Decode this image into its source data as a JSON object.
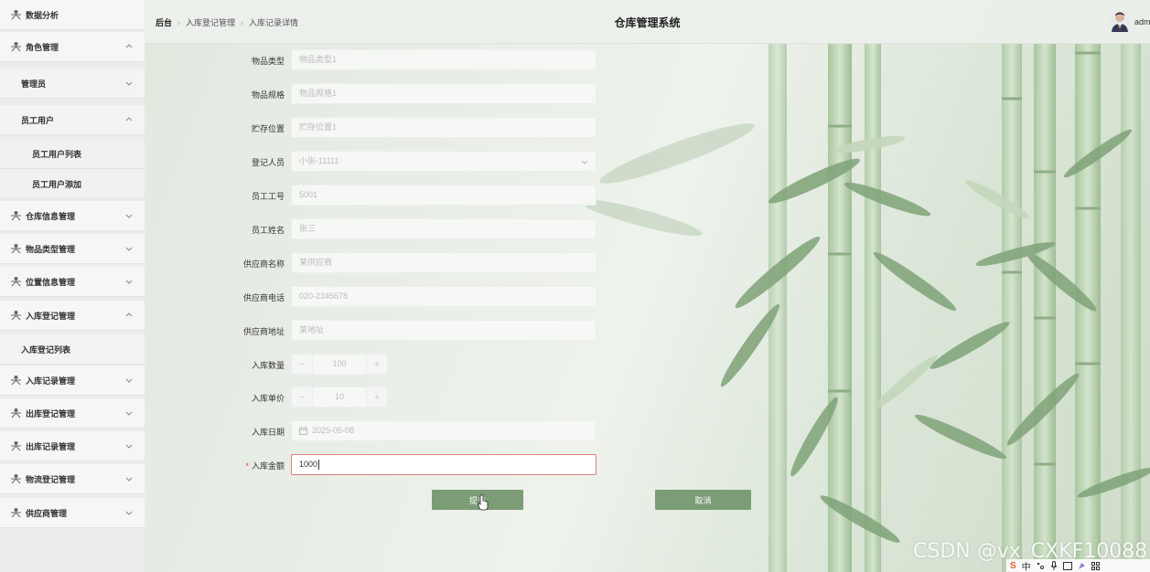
{
  "sidebar": {
    "items": [
      {
        "label": "数据分析",
        "icon": "person-icon"
      },
      {
        "label": "角色管理",
        "icon": "person-icon"
      },
      {
        "label": "管理员"
      },
      {
        "label": "员工用户"
      },
      {
        "label": "员工用户列表"
      },
      {
        "label": "员工用户添加"
      },
      {
        "label": "仓库信息管理",
        "icon": "person-icon"
      },
      {
        "label": "物品类型管理",
        "icon": "person-icon"
      },
      {
        "label": "位置信息管理",
        "icon": "person-icon"
      },
      {
        "label": "入库登记管理",
        "icon": "person-icon"
      },
      {
        "label": "入库登记列表"
      },
      {
        "label": "入库记录管理",
        "icon": "person-icon"
      },
      {
        "label": "出库登记管理",
        "icon": "person-icon"
      },
      {
        "label": "出库记录管理",
        "icon": "person-icon"
      },
      {
        "label": "物流登记管理",
        "icon": "person-icon"
      },
      {
        "label": "供应商管理",
        "icon": "person-icon"
      }
    ]
  },
  "header": {
    "breadcrumb": [
      "后台",
      "入库登记管理",
      "入库记录详情"
    ],
    "title": "仓库管理系统",
    "username": "adm"
  },
  "form": {
    "item_type": {
      "label": "物品类型",
      "placeholder": "物品类型1"
    },
    "item_spec": {
      "label": "物品规格",
      "placeholder": "物品规格1"
    },
    "storage": {
      "label": "贮存位置",
      "placeholder": "贮存位置1"
    },
    "registrar": {
      "label": "登记人员",
      "value": "小张-11111"
    },
    "emp_no": {
      "label": "员工工号",
      "value": "5001"
    },
    "emp_name": {
      "label": "员工姓名",
      "value": "张三"
    },
    "supplier_name": {
      "label": "供应商名称",
      "placeholder": "某供应商"
    },
    "supplier_phone": {
      "label": "供应商电话",
      "value": "020-2345678"
    },
    "supplier_addr": {
      "label": "供应商地址",
      "placeholder": "某地址"
    },
    "quantity": {
      "label": "入库数量",
      "value": "100",
      "minus": "−",
      "plus": "+"
    },
    "unit_price": {
      "label": "入库单价",
      "value": "10",
      "minus": "−",
      "plus": "+"
    },
    "date": {
      "label": "入库日期",
      "value": "2025-05-08"
    },
    "amount": {
      "label": "入库金额",
      "required_mark": "*",
      "value": "1000"
    }
  },
  "actions": {
    "submit": "提交",
    "cancel": "取消"
  },
  "watermark": "CSDN @vx_CXKF10088",
  "tray": {
    "logo": "S",
    "ime": "中"
  },
  "colors": {
    "button": "#7b9c76",
    "required": "#e0443a",
    "active_border": "#e08080"
  }
}
